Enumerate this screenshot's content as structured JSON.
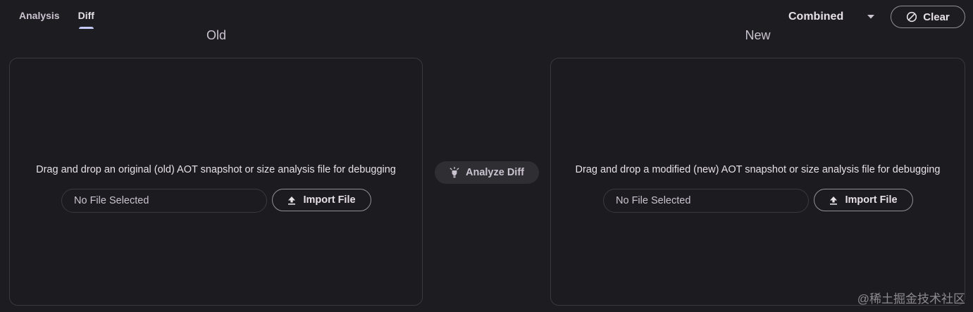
{
  "tabs": [
    {
      "label": "Analysis",
      "active": false
    },
    {
      "label": "Diff",
      "active": true
    }
  ],
  "view_select": {
    "value": "Combined",
    "icon": "chevron-down-icon"
  },
  "clear_button": {
    "label": "Clear",
    "icon": "cancel-icon"
  },
  "old": {
    "heading": "Old",
    "message": "Drag and drop an original (old) AOT snapshot or size analysis file for debugging",
    "file_field": "No File Selected",
    "import_label": "Import File"
  },
  "new": {
    "heading": "New",
    "message": "Drag and drop a modified (new) AOT snapshot or size analysis file for debugging",
    "file_field": "No File Selected",
    "import_label": "Import File"
  },
  "analyze_button": {
    "label": "Analyze Diff",
    "icon": "lightbulb-icon"
  },
  "watermark": "@稀土掘金技术社区",
  "colors": {
    "background": "#1d1c20",
    "tab_indicator": "#c4c9f5",
    "outline": "#938f99",
    "panel_border": "#3b3940"
  }
}
